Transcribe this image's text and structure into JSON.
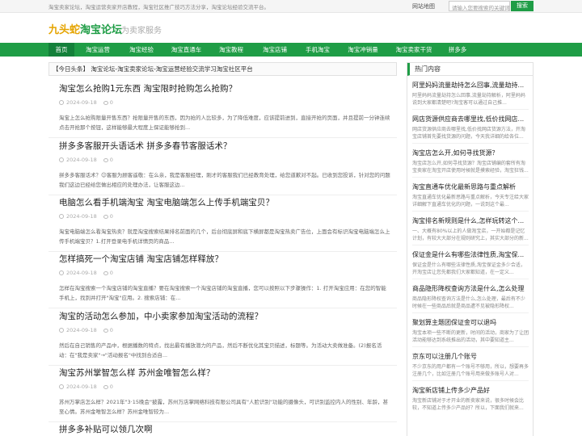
{
  "topbar": {
    "description": "淘宝卖家论坛，淘宝运营卖家开店教程，淘宝社区推广技巧方法分享，淘宝论坛经验交流平台。",
    "sitemap": "网站地图",
    "search_placeholder": "请输入您要搜索的关键词",
    "search_button": "搜索"
  },
  "logo": {
    "part1": "九头蛇",
    "part2": "淘宝论坛",
    "slogan": "为卖家服务"
  },
  "nav": [
    "首页",
    "淘宝运营",
    "淘宝经验",
    "淘宝直通车",
    "淘宝教程",
    "淘宝店铺",
    "手机淘宝",
    "淘宝冲销量",
    "淘宝卖家干货",
    "拼多多"
  ],
  "crumb": "【今日头条】 淘宝论坛-淘宝卖家论坛-淘宝运营经验交流学习淘宝社区平台",
  "articles": [
    {
      "title": "淘宝怎么抢购1元东西 淘宝限时抢购怎么抢购？",
      "date": "2024-09-18",
      "comments": "0",
      "excerpt": "淘宝上怎么抢购限量开售东西？抢限量开售的东西，因为抢的人比较多，为了降低难度，应该提前进到，直接开抢的页面，并且提前一分钟连续点击开抢那个按钮，这样能够最大程度上保证能够抢到..."
    },
    {
      "title": "拼多多客服开头语话术 拼多多春节客服话术？",
      "date": "2024-09-18",
      "comments": "0",
      "excerpt": "拼多多客服话术？☺客服为顾客遥敬：在么亲，我是客服经理，刚才的客服我们已经教育处理，给您道歉对不起。已收到您投诉，针对您的问题我们这边已经给您做出相应的处理办法，让客服这边..."
    },
    {
      "title": "电脑怎么看手机端淘宝 淘宝电脑端怎么上传手机端宝贝？",
      "date": "2024-09-18",
      "comments": "0",
      "excerpt": "淘宝电脑端怎么看淘宝热卖？就是淘宝搜索结果排名前面的几个，后台彻底屏和底下横屏都是淘宝热卖广告位，上面会有标识淘宝电脑端怎么上传手机端宝贝？1.打开登录电手机详情页的商品..."
    },
    {
      "title": "怎样搞死一个淘宝店铺 淘宝店铺怎样释放？",
      "date": "2024-09-18",
      "comments": "0",
      "excerpt": "怎样在淘宝搜索一个淘宝店铺的淘宝直播？要在淘宝搜索一个淘宝店铺的淘宝直播，您可以按照以下步骤操作：1. 打开淘宝应用：在您的智能手机上，找到并打开\"淘宝\"应用。2. 搜索店铺：在..."
    },
    {
      "title": "淘宝的活动怎么参加，中小卖家参加淘宝活动的流程？",
      "date": "2024-09-18",
      "comments": "0",
      "excerpt": "然后在自己销售的产品中，根据播数的特点，找出最有播放潜力的产品，然后不断优化其宝贝描述，标题等。为活动大卖做准备。(2)报名活动：在\"我是卖家\"→\"活动报名\"中找到合适自..."
    },
    {
      "title": "淘宝苏州掌智怎么样 苏州金唯智怎么样？",
      "date": "2024-09-18",
      "comments": "0",
      "excerpt": "苏州万掌店怎么样？2021年\"3·15晚会\"披露，苏州万店掌网络科技有限公司具有\"人脸识别\"功能的摄像头，可识别监控内人的性别、年龄，甚至心情。苏州金唯智怎么样？苏州金唯智较为..."
    },
    {
      "title": "拼多多补贴可以领几次啊",
      "date": "",
      "comments": "",
      "excerpt": ""
    }
  ],
  "sidebar": {
    "heading": "热门内容",
    "items": [
      {
        "title": "阿里妈妈流量劫持怎么回事,流量劫持...",
        "excerpt": "阿里妈妈流量劫持怎么回事,流量劫持解析，阿里妈妈说到大家都清楚吧?淘宝客可以通过自己推..."
      },
      {
        "title": "网店货源供应商去哪里找,低价找网店...",
        "excerpt": "网店货源供应商去哪里找,低价找网店货源方法，开淘宝店铺首先要找货源的问题，今天我详细的给各位..."
      },
      {
        "title": "淘宝店怎么开,如何寻找货源？",
        "excerpt": "淘宝店怎么开,如何寻找货源？淘宝店铺编的套所有淘宝卖家在淘宝开店使用时候就是摸索经验，淘宝狂钱..."
      },
      {
        "title": "淘宝直通车优化最新思路与重点解析",
        "excerpt": "淘宝直通车优化最新思路与重点解析，今天专注给大家详细解下直通车优化的问题，一说到这个最..."
      },
      {
        "title": "淘宝排名新规则是什么,怎样玩转这个...",
        "excerpt": "一、大概有80%以上的人做淘宝店，一开始都是记忆计划，有较大大部分在规则研究上，其实大部分的新..."
      },
      {
        "title": "保证金是什么有哪些法律性质,淘宝保...",
        "excerpt": "保证金是什么有哪些法律性质,淘宝保证金多少合适，开淘宝店让您先都我们大家都知道，在一定义..."
      },
      {
        "title": "商品隐形降权查询方法是什么,怎么处理",
        "excerpt": "商品隐形降权查询方法是什么,怎么处理，最后有不少时候在一些商品后就是商品遭不见被隐形降权..."
      },
      {
        "title": "聚划算主题团保证金可以退吗",
        "excerpt": "淘宝本项一些不断的更新，时间的活动，商家为了让团活动能够达到系统推出的活动，其中要知道主..."
      },
      {
        "title": "京东可以注册几个账号",
        "excerpt": "不少京东的用户都有一个账号不够用，所以，想要再多注册几个，比如注册几个账号用来做多账号人对..."
      },
      {
        "title": "淘宝新店铺上传多少产品好",
        "excerpt": "淘宝新店铺对于才开业的新卖家来说，很多时候会比较，不知道上传多少产品好？所以，下面我们就来..."
      }
    ]
  }
}
